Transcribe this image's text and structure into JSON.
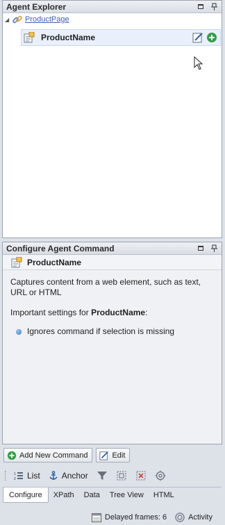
{
  "explorer": {
    "title": "Agent Explorer",
    "root_label": "ProductPage",
    "child_label": "ProductName"
  },
  "configure": {
    "title": "Configure Agent Command",
    "command_name": "ProductName",
    "description": "Captures content from a web element, such as text, URL or HTML",
    "settings_prefix": "Important settings for ",
    "settings_target": "ProductName",
    "settings_suffix": ":",
    "settings": [
      "Ignores command if selection is missing"
    ]
  },
  "buttons": {
    "add_new_command": "Add New Command",
    "edit": "Edit"
  },
  "toolbar": {
    "list": "List",
    "anchor": "Anchor"
  },
  "tabs": [
    "Configure",
    "XPath",
    "Data",
    "Tree View",
    "HTML"
  ],
  "status": {
    "delayed_frames": "Delayed frames: 6",
    "activity": "Activity"
  },
  "icons": {
    "root": "link-icon",
    "child": "capture-tool-icon",
    "edit": "edit-icon",
    "add": "add-circle-icon"
  },
  "colors": {
    "link": "#3a5db8",
    "selection": "#eaf0fb",
    "add_green": "#2f9e44"
  }
}
